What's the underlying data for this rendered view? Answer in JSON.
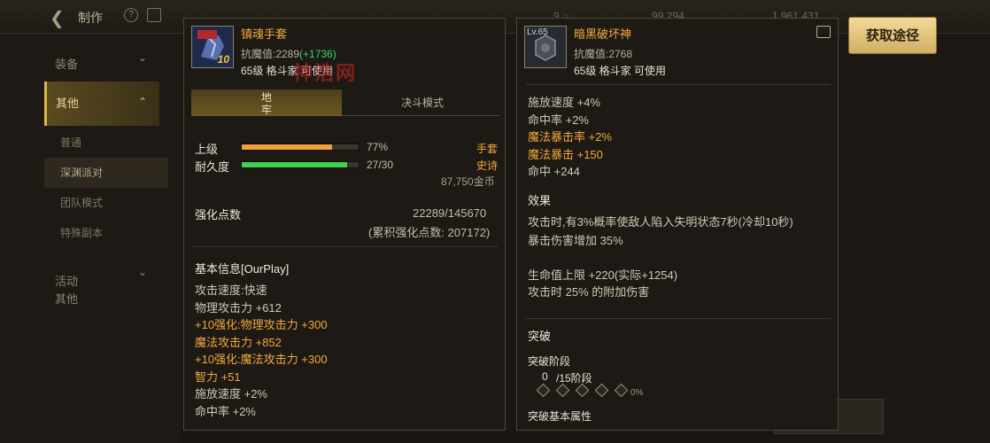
{
  "topbar": {
    "back_icon": "back-arrow-icon",
    "title": "制作",
    "help": "?",
    "stats": [
      "9 ○",
      "99,294",
      "1,961,431"
    ]
  },
  "sidebar": {
    "items": [
      {
        "label": "装备"
      },
      {
        "label": "其他"
      },
      {
        "label": "活动\n其他"
      }
    ],
    "subs": [
      "普通",
      "深渊派对",
      "团队模式",
      "特殊副本"
    ]
  },
  "get_button": "获取途径",
  "watermark": "神浩网",
  "left": {
    "name": "镇魂手套",
    "resist_label": "抗魔值:2289",
    "resist_bonus": "(+1736)",
    "level_line": "65级 格斗家 可使用",
    "icon_tag": "10",
    "tabs": [
      "地\n牢",
      "决斗模式"
    ],
    "rows": [
      {
        "label": "上级",
        "percent": "77%",
        "fill": 0.77,
        "color": "#f0a238"
      },
      {
        "label": "耐久度",
        "percent": "27/30",
        "fill": 0.9,
        "color": "#3fd24f"
      }
    ],
    "type": "手套",
    "rarity": "史诗",
    "price": "87,750金币",
    "enhance_label": "强化点数",
    "enhance_value": "22289/145670",
    "enhance_total": "(累积强化点数: 207172)",
    "basic_title": "基本信息[OurPlay]",
    "stats": [
      {
        "t": "攻击速度:快速",
        "o": false
      },
      {
        "t": "物理攻击力 +612",
        "o": false
      },
      {
        "t": "+10强化:物理攻击力 +300",
        "o": true
      },
      {
        "t": "魔法攻击力 +852",
        "o": true
      },
      {
        "t": "+10强化:魔法攻击力 +300",
        "o": true
      },
      {
        "t": "智力 +51",
        "o": true
      },
      {
        "t": "施放速度 +2%",
        "o": false
      },
      {
        "t": "命中率 +2%",
        "o": false
      }
    ]
  },
  "right": {
    "name": "暗黑破坏神",
    "resist_label": "抗魔值:2768",
    "level_line": "65级 格斗家 可使用",
    "icon_lv": "Lv.65",
    "stats_top": [
      {
        "t": "施放速度 +4%",
        "o": false
      },
      {
        "t": "命中率 +2%",
        "o": false
      },
      {
        "t": "魔法暴击率 +2%",
        "o": true
      },
      {
        "t": "魔法暴击 +150",
        "o": true
      },
      {
        "t": "命中 +244",
        "o": false
      }
    ],
    "effect_title": "效果",
    "effect_lines": [
      "攻击时,有3%概率使敌人陷入失明状态7秒(冷却10秒)",
      "暴击伤害增加 35%",
      "生命值上限 +220(实际+1254)",
      "攻击时 25% 的附加伤害"
    ],
    "break_title": "突破",
    "break_stage_label": "突破阶段",
    "break_current": "0",
    "break_total": "/15阶段",
    "break_percent": "0%",
    "break_base": "突破基本属性"
  }
}
